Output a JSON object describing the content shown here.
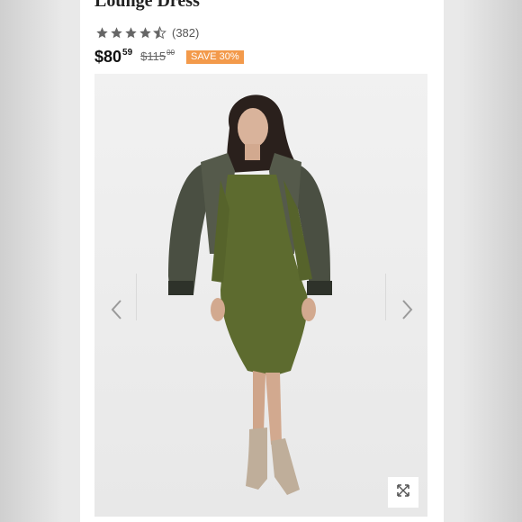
{
  "product": {
    "title": "Lounge Dress",
    "rating": {
      "value": 4.5,
      "max": 5,
      "count_label": "(382)"
    },
    "price": {
      "current_dollars": "$80",
      "current_cents": "59",
      "original_dollars": "$115",
      "original_cents": "00",
      "discount_badge": "SAVE 30%"
    }
  },
  "gallery": {
    "prev_icon": "chevron-left-icon",
    "next_icon": "chevron-right-icon",
    "zoom_icon": "expand-icon"
  },
  "colors": {
    "badge": "#f39a4b",
    "star": "#666666",
    "dress": "#5d6b2f",
    "jacket": "#4a4f42"
  }
}
